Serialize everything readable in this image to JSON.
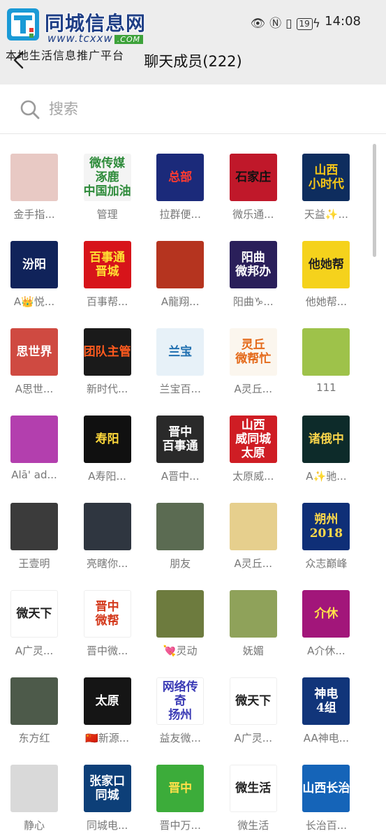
{
  "status_bar": {
    "battery": "19",
    "time": "14:08"
  },
  "watermark": {
    "name": "同城信息网",
    "url": "www.tcxxw",
    "url_suffix": ".COM",
    "tagline": "本地生活信息推广平台"
  },
  "header": {
    "title": "聊天成员(222)"
  },
  "search": {
    "placeholder": "搜索"
  },
  "members": [
    {
      "name": "金手指...",
      "avatar_text": "",
      "bg": "#e8c9c4",
      "fg": "#ffffff"
    },
    {
      "name": "管理",
      "avatar_text": "微传媒\n涿鹿\n中国加油",
      "bg": "#f4f4f4",
      "fg": "#2e8b3a"
    },
    {
      "name": "拉群便...",
      "avatar_text": "总部",
      "bg": "#1b2a7a",
      "fg": "#ff3b30"
    },
    {
      "name": "微乐通...",
      "avatar_text": "石家庄",
      "bg": "#c0182a",
      "fg": "#111111"
    },
    {
      "name": "天益✨...",
      "avatar_text": "山西\n小时代",
      "bg": "#0e2d5e",
      "fg": "#f5c518"
    },
    {
      "name": "A👑悦...",
      "avatar_text": "汾阳",
      "bg": "#10235a",
      "fg": "#ffffff"
    },
    {
      "name": "百事帮...",
      "avatar_text": "百事通\n晋城",
      "bg": "#d7141a",
      "fg": "#ffe033"
    },
    {
      "name": "A龍翔...",
      "avatar_text": "",
      "bg": "#b5341f",
      "fg": "#ffffff"
    },
    {
      "name": "阳曲♑...",
      "avatar_text": "阳曲\n微邦办",
      "bg": "#2a1f5a",
      "fg": "#ffffff"
    },
    {
      "name": "他她帮...",
      "avatar_text": "他她帮",
      "bg": "#f5d21c",
      "fg": "#222222"
    },
    {
      "name": "A思世...",
      "avatar_text": "思世界",
      "bg": "#cf4a41",
      "fg": "#ffffff"
    },
    {
      "name": "新时代...",
      "avatar_text": "团队主管",
      "bg": "#1a1a1a",
      "fg": "#ff5a1e"
    },
    {
      "name": "兰宝百...",
      "avatar_text": "兰宝",
      "bg": "#e7f1f8",
      "fg": "#1f6fb0"
    },
    {
      "name": "A灵丘...",
      "avatar_text": "灵丘\n微帮忙",
      "bg": "#fbf6ee",
      "fg": "#e46a1a"
    },
    {
      "name": "111",
      "avatar_text": "",
      "bg": "#9ec24a",
      "fg": "#ffffff"
    },
    {
      "name": "Alā' ad...",
      "avatar_text": "",
      "bg": "#b33fae",
      "fg": "#ffffff"
    },
    {
      "name": "A寿阳...",
      "avatar_text": "寿阳",
      "bg": "#101010",
      "fg": "#ffd93b"
    },
    {
      "name": "A晋中...",
      "avatar_text": "晋中\n百事通",
      "bg": "#2a2a2a",
      "fg": "#ffffff"
    },
    {
      "name": "太原威...",
      "avatar_text": "山西\n威同城\n太原",
      "bg": "#cf1d24",
      "fg": "#ffffff"
    },
    {
      "name": "A✨驰...",
      "avatar_text": "诸俄中",
      "bg": "#0d2b2a",
      "fg": "#f7d34a"
    },
    {
      "name": "王壹明",
      "avatar_text": "",
      "bg": "#3b3b3b",
      "fg": "#ffffff"
    },
    {
      "name": "亮瞎你...",
      "avatar_text": "",
      "bg": "#2f3640",
      "fg": "#cccccc"
    },
    {
      "name": "朋友",
      "avatar_text": "",
      "bg": "#5b6b52",
      "fg": "#ffffff"
    },
    {
      "name": "A灵丘...",
      "avatar_text": "",
      "bg": "#e6cf8d",
      "fg": "#444444"
    },
    {
      "name": "众志巅峰",
      "avatar_text": "朔州\n2018",
      "bg": "#0f2f77",
      "fg": "#ffd94a"
    },
    {
      "name": "A广灵...",
      "avatar_text": "微天下",
      "bg": "#ffffff",
      "fg": "#222222"
    },
    {
      "name": "晋中微...",
      "avatar_text": "晋中\n微帮",
      "bg": "#ffffff",
      "fg": "#d43a1d"
    },
    {
      "name": "💘灵动",
      "avatar_text": "",
      "bg": "#6d7b3e",
      "fg": "#ffffff"
    },
    {
      "name": "妩媚",
      "avatar_text": "",
      "bg": "#8fa25a",
      "fg": "#ffffff"
    },
    {
      "name": "A介休...",
      "avatar_text": "介休",
      "bg": "#a2167a",
      "fg": "#ffe04a"
    },
    {
      "name": "东方红",
      "avatar_text": "",
      "bg": "#4d5a4a",
      "fg": "#ffffff"
    },
    {
      "name": "🇨🇳新源...",
      "avatar_text": "太原",
      "bg": "#151515",
      "fg": "#ffffff"
    },
    {
      "name": "益友微...",
      "avatar_text": "网络传奇\n扬州",
      "bg": "#ffffff",
      "fg": "#3b3bb5"
    },
    {
      "name": "A广灵...",
      "avatar_text": "微天下",
      "bg": "#ffffff",
      "fg": "#222222"
    },
    {
      "name": "AA神电...",
      "avatar_text": "神电\n4组",
      "bg": "#11357a",
      "fg": "#ffffff"
    },
    {
      "name": "静心",
      "avatar_text": "",
      "bg": "#d9d9d9",
      "fg": "#333333"
    },
    {
      "name": "同城电...",
      "avatar_text": "张家口\n同城",
      "bg": "#0d3f78",
      "fg": "#ffffff"
    },
    {
      "name": "晋中万...",
      "avatar_text": "晋中",
      "bg": "#3cac3a",
      "fg": "#ffe04a"
    },
    {
      "name": "微生活",
      "avatar_text": "微生活",
      "bg": "#ffffff",
      "fg": "#222222"
    },
    {
      "name": "长治百...",
      "avatar_text": "山西长治",
      "bg": "#1564b8",
      "fg": "#ffffff"
    }
  ]
}
